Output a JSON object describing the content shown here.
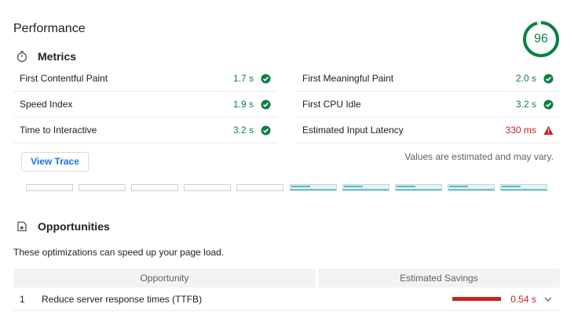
{
  "performance": {
    "title": "Performance",
    "score": "96",
    "score_fraction": 0.96,
    "score_color": "#0b8043"
  },
  "metrics": {
    "heading": "Metrics",
    "icon": "stopwatch-icon",
    "items": [
      {
        "label": "First Contentful Paint",
        "value": "1.7 s",
        "status": "pass"
      },
      {
        "label": "First Meaningful Paint",
        "value": "2.0 s",
        "status": "pass"
      },
      {
        "label": "Speed Index",
        "value": "1.9 s",
        "status": "pass"
      },
      {
        "label": "First CPU Idle",
        "value": "3.2 s",
        "status": "pass"
      },
      {
        "label": "Time to Interactive",
        "value": "3.2 s",
        "status": "pass"
      },
      {
        "label": "Estimated Input Latency",
        "value": "330 ms",
        "status": "fail"
      }
    ],
    "view_trace_label": "View Trace",
    "note": "Values are estimated and may vary."
  },
  "filmstrip": {
    "frames": [
      "blank",
      "blank",
      "blank",
      "blank",
      "blank",
      "loaded",
      "loaded",
      "loaded",
      "loaded",
      "loaded"
    ]
  },
  "opportunities": {
    "heading": "Opportunities",
    "icon": "opportunity-icon",
    "description": "These optimizations can speed up your page load.",
    "columns": [
      "Opportunity",
      "Estimated Savings"
    ],
    "rows": [
      {
        "index": "1",
        "name": "Reduce server response times (TTFB)",
        "savings": "0.54 s"
      }
    ]
  },
  "colors": {
    "pass": "#0b8043",
    "fail": "#c7221f",
    "link": "#1a73e8"
  }
}
